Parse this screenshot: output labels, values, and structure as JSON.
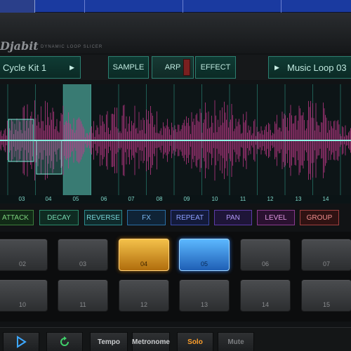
{
  "app": {
    "brand": "Djabit",
    "brand_subtitle": "DYNAMIC LOOP SLICER"
  },
  "controls": {
    "kit_label": "Cycle Kit 1",
    "sample_label": "SAMPLE",
    "arp_label": "ARP",
    "effect_label": "EFFECT",
    "loop_label": "Music Loop 03",
    "arrow_icon": "chevron-right-icon"
  },
  "waveform": {
    "ticks": [
      "03",
      "04",
      "05",
      "06",
      "07",
      "08",
      "09",
      "10",
      "11",
      "12",
      "13",
      "14"
    ]
  },
  "effects": {
    "attack": "ATTACK",
    "decay": "DECAY",
    "reverse": "REVERSE",
    "fx": "FX",
    "repeat": "REPEAT",
    "pan": "PAN",
    "level": "LEVEL",
    "group": "GROUP"
  },
  "pads": {
    "row1": [
      "02",
      "03",
      "04",
      "05",
      "06",
      "07"
    ],
    "row2": [
      "10",
      "11",
      "12",
      "13",
      "14",
      "15"
    ],
    "active_orange": "04",
    "active_blue": "05"
  },
  "transport": {
    "tempo": "Tempo",
    "metronome": "Metronome",
    "solo": "Solo",
    "mute": "Mute"
  },
  "colors": {
    "accent_teal": "#2c7f70",
    "pad_orange": "#f4c14a",
    "pad_blue": "#5cb8ff",
    "solo_orange": "#ff9f2a"
  }
}
